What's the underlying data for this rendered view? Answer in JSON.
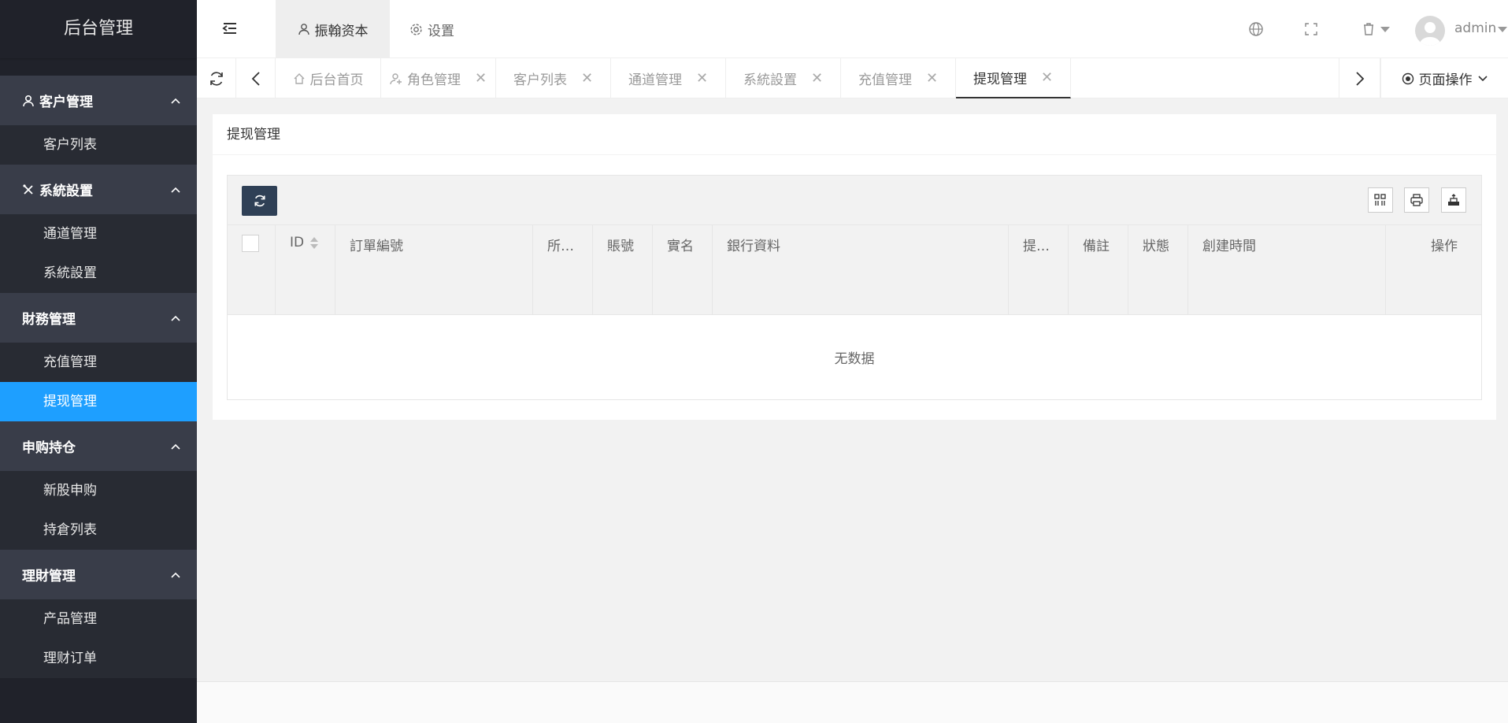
{
  "app": {
    "title": "后台管理"
  },
  "sidebar": {
    "groups": [
      {
        "label": "客户管理",
        "icon": "user-icon",
        "items": [
          "客户列表"
        ]
      },
      {
        "label": "系統設置",
        "icon": "tools-icon",
        "items": [
          "通道管理",
          "系統設置"
        ]
      },
      {
        "label": "財務管理",
        "icon": "",
        "items": [
          "充值管理",
          "提现管理"
        ]
      },
      {
        "label": "申购持仓",
        "icon": "",
        "items": [
          "新股申购",
          "持倉列表"
        ]
      },
      {
        "label": "理財管理",
        "icon": "",
        "items": [
          "产品管理",
          "理财订单"
        ]
      }
    ],
    "active_item": "提现管理"
  },
  "header": {
    "tabs": [
      {
        "label": "振翰资本",
        "icon": "user-icon",
        "active": true
      },
      {
        "label": "设置",
        "icon": "gear-icon",
        "active": false
      }
    ],
    "user": "admin"
  },
  "tabbar": {
    "tabs": [
      {
        "label": "后台首页",
        "icon": "home-icon",
        "closable": false,
        "active": false
      },
      {
        "label": "角色管理",
        "icon": "user-add-icon",
        "closable": true,
        "active": false
      },
      {
        "label": "客户列表",
        "closable": true,
        "active": false
      },
      {
        "label": "通道管理",
        "closable": true,
        "active": false
      },
      {
        "label": "系統設置",
        "closable": true,
        "active": false
      },
      {
        "label": "充值管理",
        "closable": true,
        "active": false
      },
      {
        "label": "提现管理",
        "closable": true,
        "active": true
      }
    ],
    "close_glyph": "✕",
    "page_ops": "页面操作"
  },
  "content": {
    "card_title": "提现管理",
    "columns": [
      "ID",
      "訂單編號",
      "所…",
      "賬號",
      "實名",
      "銀行資料",
      "提…",
      "備註",
      "狀態",
      "創建時間",
      "操作"
    ],
    "empty_text": "无数据"
  },
  "colors": {
    "sidebar_bg": "#20222a",
    "group_bg": "#393d49",
    "active_blue": "#1e9fff",
    "refresh_btn": "#2f4056"
  }
}
